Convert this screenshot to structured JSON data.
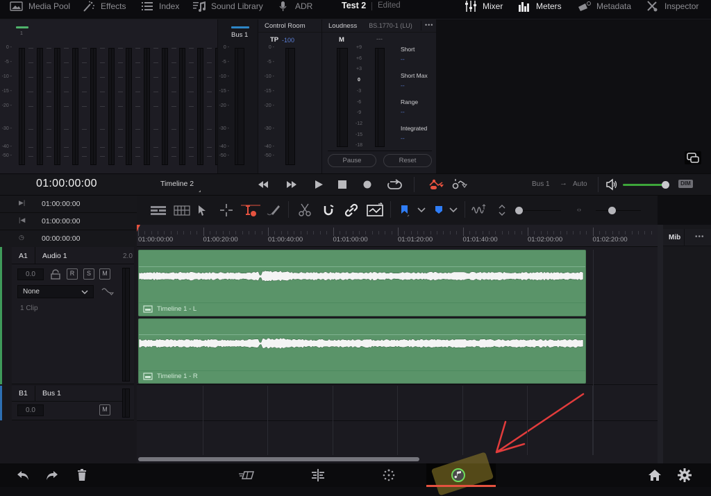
{
  "topbar": {
    "items": [
      {
        "label": "Media Pool",
        "icon": "media-pool-icon"
      },
      {
        "label": "Effects",
        "icon": "effects-icon"
      },
      {
        "label": "Index",
        "icon": "index-icon"
      },
      {
        "label": "Sound Library",
        "icon": "sound-library-icon"
      },
      {
        "label": "ADR",
        "icon": "microphone-icon"
      }
    ],
    "project_title": "Test 2",
    "project_status": "Edited",
    "right_items": [
      {
        "label": "Mixer",
        "icon": "mixer-icon"
      },
      {
        "label": "Meters",
        "icon": "meters-icon"
      },
      {
        "label": "Metadata",
        "icon": "metadata-icon"
      },
      {
        "label": "Inspector",
        "icon": "inspector-icon"
      }
    ]
  },
  "meters": {
    "track_channel_label": "1",
    "scale": [
      "0",
      "-5",
      "-10",
      "-15",
      "-20",
      "-30",
      "-40",
      "-50"
    ],
    "bus_label": "Bus 1",
    "control_room": {
      "title": "Control Room",
      "tp_label": "TP",
      "tp_value": "-100"
    },
    "loudness": {
      "title": "Loudness",
      "standard": "BS.1770-1 (LU)",
      "more": "•••",
      "m_label": "M",
      "second_label": "---",
      "scale": [
        "+9",
        "+6",
        "+3",
        "0",
        "-3",
        "-6",
        "-9",
        "-12",
        "-15",
        "-18"
      ],
      "stats": [
        {
          "label": "Short",
          "value": "--"
        },
        {
          "label": "Short Max",
          "value": "--"
        },
        {
          "label": "Range",
          "value": "--"
        },
        {
          "label": "Integrated",
          "value": "--"
        }
      ],
      "pause_label": "Pause",
      "reset_label": "Reset"
    }
  },
  "transport": {
    "timecode": "01:00:00:00",
    "timeline_name": "Timeline 2",
    "bus_route": "Bus 1",
    "arrow": "→",
    "route_target": "Auto",
    "dim_label": "DIM",
    "volume_fraction": 0.92
  },
  "tc_rows": [
    {
      "icon": "in-point-icon",
      "glyph": "▶|",
      "value": "01:00:00:00"
    },
    {
      "icon": "out-point-icon",
      "glyph": "|◀",
      "value": "01:00:00:00"
    },
    {
      "icon": "duration-clock-icon",
      "glyph": "◷",
      "value": "00:00:00:00"
    }
  ],
  "ruler": {
    "labels": [
      "01:00:00:00",
      "01:00:20:00",
      "01:00:40:00",
      "01:01:00:00",
      "01:01:20:00",
      "01:01:40:00",
      "01:02:00:00",
      "01:02:20:00"
    ]
  },
  "side_panel": {
    "tab_label": "Miв",
    "more": "•••"
  },
  "tracks": [
    {
      "id": "A1",
      "name": "Audio 1",
      "format": "2.0",
      "volume": "0.0",
      "buttons": [
        "R",
        "S",
        "M"
      ],
      "dropdown": "None",
      "clip_count": "1 Clip"
    },
    {
      "id": "B1",
      "name": "Bus 1",
      "volume": "0.0",
      "buttons": [
        "M"
      ]
    }
  ],
  "clips": [
    {
      "label": "Timeline 1 - L"
    },
    {
      "label": "Timeline 1 - R"
    }
  ],
  "colors": {
    "accent_red": "#e5523f",
    "clip_green": "#5a9469",
    "marker_blue": "#2f7df6",
    "track_green": "#3f9a5a",
    "bus_blue": "#2d6fb3"
  }
}
